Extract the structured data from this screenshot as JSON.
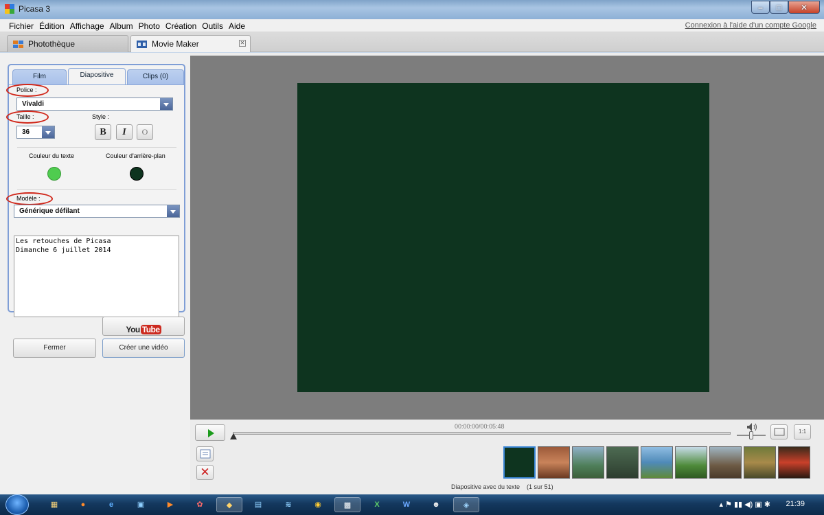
{
  "window": {
    "title": "Picasa 3"
  },
  "menu": {
    "items": [
      "Fichier",
      "Édition",
      "Affichage",
      "Album",
      "Photo",
      "Création",
      "Outils",
      "Aide"
    ],
    "account_link": "Connexion à l'aide d'un compte Google"
  },
  "tabs": {
    "library": "Photothèque",
    "movie_maker": "Movie Maker"
  },
  "panel": {
    "tabs": {
      "film": "Film",
      "diapositive": "Diapositive",
      "clips": "Clips (0)"
    },
    "font_label": "Police :",
    "font_value": "Vivaldi",
    "size_label": "Taille :",
    "size_value": "36",
    "style_label": "Style :",
    "bold": "B",
    "italic": "I",
    "outline": "O",
    "text_color_label": "Couleur du texte",
    "bg_color_label": "Couleur d'arrière-plan",
    "template_label": "Modèle :",
    "template_value": "Générique défilant",
    "slide_text": "Les retouches de Picasa\nDimanche 6 juillet 2014",
    "text_color": "#4fcc4f",
    "bg_color": "#0e341f"
  },
  "buttons": {
    "youtube_you": "You",
    "youtube_tube": "Tube",
    "close": "Fermer",
    "create_video": "Créer une vidéo"
  },
  "player": {
    "time": "00:00:00/00:05:48",
    "ratio_label": "1:1",
    "caption": "Diapositive avec du texte    (1 sur 51)"
  },
  "taskbar": {
    "clock": "21:39"
  }
}
